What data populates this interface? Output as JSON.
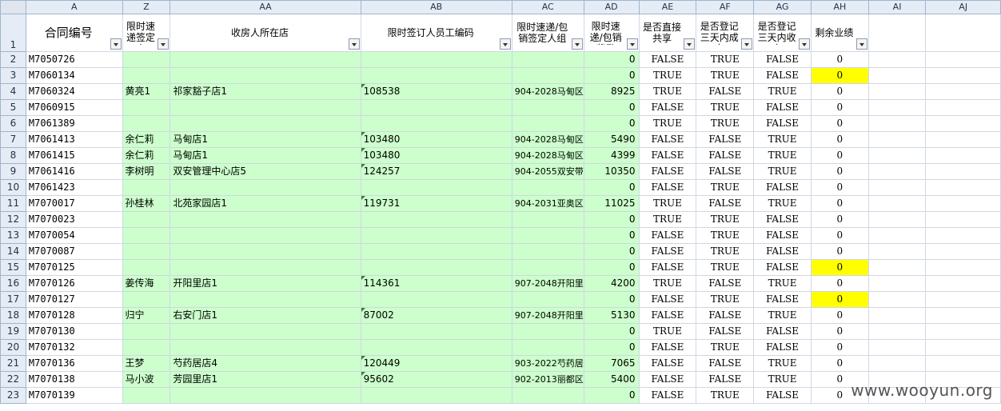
{
  "columns": [
    "A",
    "Z",
    "AA",
    "AB",
    "AC",
    "AD",
    "AE",
    "AF",
    "AG",
    "AH",
    "AI",
    "AJ"
  ],
  "header_row": {
    "row_number": "1",
    "contract_no": "合同编号",
    "signer": "限时速递签定人",
    "store": "收房人所在店",
    "employee_id": "限时签订人员工编码",
    "group": "限时速递/包销签定人组",
    "bonus": "限时速递/包销奖励",
    "shared": "是否直接共享",
    "three_day_deal": "是否登记三天内成交",
    "three_day_collect": "是否登记三天内收房",
    "remaining": "剩余业绩"
  },
  "rows": [
    {
      "row": "2",
      "contract": "M7050726",
      "signer": "",
      "store": "",
      "emp": "",
      "group": "",
      "bonus": "0",
      "shared": "FALSE",
      "deal": "TRUE",
      "collect": "FALSE",
      "remaining": "0",
      "highlight": false
    },
    {
      "row": "3",
      "contract": "M7060134",
      "signer": "",
      "store": "",
      "emp": "",
      "group": "",
      "bonus": "0",
      "shared": "TRUE",
      "deal": "TRUE",
      "collect": "FALSE",
      "remaining": "0",
      "highlight": true
    },
    {
      "row": "4",
      "contract": "M7060324",
      "signer": "黄亮1",
      "store": "祁家豁子店1",
      "emp": "108538",
      "group": "904-2028马甸区",
      "bonus": "8925",
      "shared": "TRUE",
      "deal": "FALSE",
      "collect": "TRUE",
      "remaining": "0",
      "highlight": false
    },
    {
      "row": "5",
      "contract": "M7060915",
      "signer": "",
      "store": "",
      "emp": "",
      "group": "",
      "bonus": "0",
      "shared": "FALSE",
      "deal": "TRUE",
      "collect": "FALSE",
      "remaining": "0",
      "highlight": false
    },
    {
      "row": "6",
      "contract": "M7061389",
      "signer": "",
      "store": "",
      "emp": "",
      "group": "",
      "bonus": "0",
      "shared": "TRUE",
      "deal": "TRUE",
      "collect": "FALSE",
      "remaining": "0",
      "highlight": false
    },
    {
      "row": "7",
      "contract": "M7061413",
      "signer": "余仁莉",
      "store": "马甸店1",
      "emp": "103480",
      "group": "904-2028马甸区",
      "bonus": "5490",
      "shared": "FALSE",
      "deal": "FALSE",
      "collect": "TRUE",
      "remaining": "0",
      "highlight": false
    },
    {
      "row": "8",
      "contract": "M7061415",
      "signer": "余仁莉",
      "store": "马甸店1",
      "emp": "103480",
      "group": "904-2028马甸区",
      "bonus": "4399",
      "shared": "FALSE",
      "deal": "FALSE",
      "collect": "TRUE",
      "remaining": "0",
      "highlight": false
    },
    {
      "row": "9",
      "contract": "M7061416",
      "signer": "李树明",
      "store": "双安管理中心店5",
      "emp": "124257",
      "group": "904-2055双安带",
      "bonus": "10350",
      "shared": "FALSE",
      "deal": "FALSE",
      "collect": "TRUE",
      "remaining": "0",
      "highlight": false
    },
    {
      "row": "10",
      "contract": "M7061423",
      "signer": "",
      "store": "",
      "emp": "",
      "group": "",
      "bonus": "0",
      "shared": "FALSE",
      "deal": "TRUE",
      "collect": "FALSE",
      "remaining": "0",
      "highlight": false
    },
    {
      "row": "11",
      "contract": "M7070017",
      "signer": "孙桂林",
      "store": "北苑家园店1",
      "emp": "119731",
      "group": "904-2031亚奥区",
      "bonus": "11025",
      "shared": "TRUE",
      "deal": "FALSE",
      "collect": "TRUE",
      "remaining": "0",
      "highlight": false
    },
    {
      "row": "12",
      "contract": "M7070023",
      "signer": "",
      "store": "",
      "emp": "",
      "group": "",
      "bonus": "0",
      "shared": "TRUE",
      "deal": "TRUE",
      "collect": "FALSE",
      "remaining": "0",
      "highlight": false
    },
    {
      "row": "13",
      "contract": "M7070054",
      "signer": "",
      "store": "",
      "emp": "",
      "group": "",
      "bonus": "0",
      "shared": "FALSE",
      "deal": "TRUE",
      "collect": "FALSE",
      "remaining": "0",
      "highlight": false
    },
    {
      "row": "14",
      "contract": "M7070087",
      "signer": "",
      "store": "",
      "emp": "",
      "group": "",
      "bonus": "0",
      "shared": "FALSE",
      "deal": "TRUE",
      "collect": "FALSE",
      "remaining": "0",
      "highlight": false
    },
    {
      "row": "15",
      "contract": "M7070125",
      "signer": "",
      "store": "",
      "emp": "",
      "group": "",
      "bonus": "0",
      "shared": "FALSE",
      "deal": "TRUE",
      "collect": "FALSE",
      "remaining": "0",
      "highlight": true
    },
    {
      "row": "16",
      "contract": "M7070126",
      "signer": "姜传海",
      "store": "开阳里店1",
      "emp": "114361",
      "group": "907-2048开阳里",
      "bonus": "4200",
      "shared": "TRUE",
      "deal": "FALSE",
      "collect": "TRUE",
      "remaining": "0",
      "highlight": false
    },
    {
      "row": "17",
      "contract": "M7070127",
      "signer": "",
      "store": "",
      "emp": "",
      "group": "",
      "bonus": "0",
      "shared": "FALSE",
      "deal": "TRUE",
      "collect": "FALSE",
      "remaining": "0",
      "highlight": true
    },
    {
      "row": "18",
      "contract": "M7070128",
      "signer": "归宁",
      "store": "右安门店1",
      "emp": "87002",
      "group": "907-2048开阳里",
      "bonus": "5130",
      "shared": "FALSE",
      "deal": "FALSE",
      "collect": "TRUE",
      "remaining": "0",
      "highlight": false
    },
    {
      "row": "19",
      "contract": "M7070130",
      "signer": "",
      "store": "",
      "emp": "",
      "group": "",
      "bonus": "0",
      "shared": "TRUE",
      "deal": "FALSE",
      "collect": "FALSE",
      "remaining": "0",
      "highlight": false
    },
    {
      "row": "20",
      "contract": "M7070132",
      "signer": "",
      "store": "",
      "emp": "",
      "group": "",
      "bonus": "0",
      "shared": "FALSE",
      "deal": "TRUE",
      "collect": "FALSE",
      "remaining": "0",
      "highlight": false
    },
    {
      "row": "21",
      "contract": "M7070136",
      "signer": "王梦",
      "store": "芍药居店4",
      "emp": "120449",
      "group": "903-2022芍药居",
      "bonus": "7065",
      "shared": "FALSE",
      "deal": "FALSE",
      "collect": "TRUE",
      "remaining": "0",
      "highlight": false
    },
    {
      "row": "22",
      "contract": "M7070138",
      "signer": "马小波",
      "store": "芳园里店1",
      "emp": "95602",
      "group": "902-2013丽都区",
      "bonus": "5400",
      "shared": "FALSE",
      "deal": "FALSE",
      "collect": "TRUE",
      "remaining": "0",
      "highlight": false
    },
    {
      "row": "23",
      "contract": "M7070139",
      "signer": "",
      "store": "",
      "emp": "",
      "group": "",
      "bonus": "0",
      "shared": "FALSE",
      "deal": "TRUE",
      "collect": "FALSE",
      "remaining": "0",
      "highlight": false
    }
  ],
  "watermark": "www.wooyun.org",
  "colors": {
    "green_fill": "#ccffcc",
    "yellow_fill": "#ffff00",
    "header_bg": "#e6ecf5",
    "gridline": "#d0d7e5"
  }
}
